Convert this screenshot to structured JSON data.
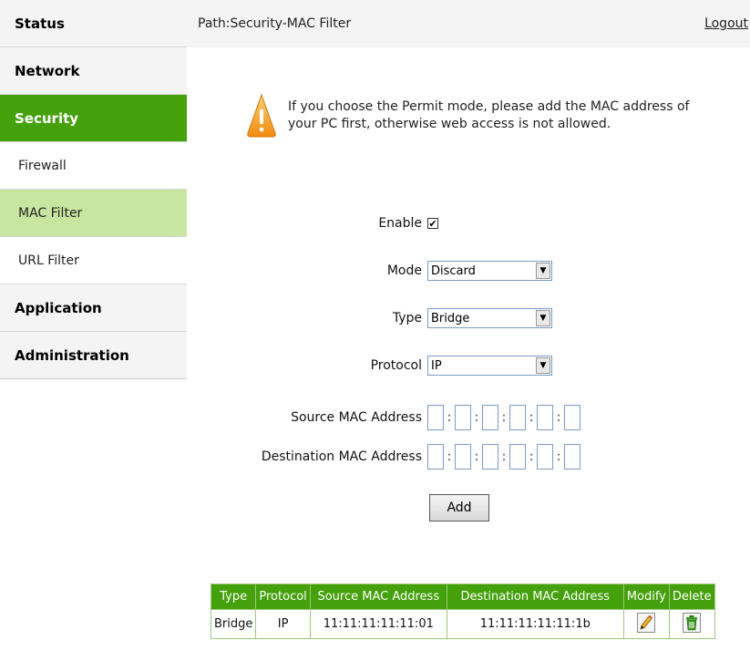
{
  "sidebar": {
    "items": [
      {
        "label": "Status"
      },
      {
        "label": "Network"
      },
      {
        "label": "Security"
      },
      {
        "label": "Firewall"
      },
      {
        "label": "MAC Filter"
      },
      {
        "label": "URL Filter"
      },
      {
        "label": "Application"
      },
      {
        "label": "Administration"
      }
    ]
  },
  "header": {
    "path": "Path:Security-MAC Filter",
    "logout": "Logout"
  },
  "notice": {
    "line1": "If you choose the Permit mode, please add the MAC address of",
    "line2": "your PC first, otherwise web access is not allowed.",
    "icon": "warning-icon"
  },
  "form": {
    "enable_label": "Enable",
    "enable_checked": "✔",
    "mode_label": "Mode",
    "mode_value": "Discard",
    "type_label": "Type",
    "type_value": "Bridge",
    "protocol_label": "Protocol",
    "protocol_value": "IP",
    "source_mac_label": "Source MAC Address",
    "dest_mac_label": "Destination MAC Address",
    "mac_separator": ":",
    "add_label": "Add"
  },
  "table": {
    "headers": [
      "Type",
      "Protocol",
      "Source MAC Address",
      "Destination MAC Address",
      "Modify",
      "Delete"
    ],
    "rows": [
      {
        "type": "Bridge",
        "protocol": "IP",
        "source_mac": "11:11:11:11:11:01",
        "dest_mac": "11:11:11:11:11:1b"
      }
    ]
  },
  "colors": {
    "accent_green": "#44a10c",
    "sub_active": "#c8e6a0",
    "warning_orange": "#f0a020"
  }
}
